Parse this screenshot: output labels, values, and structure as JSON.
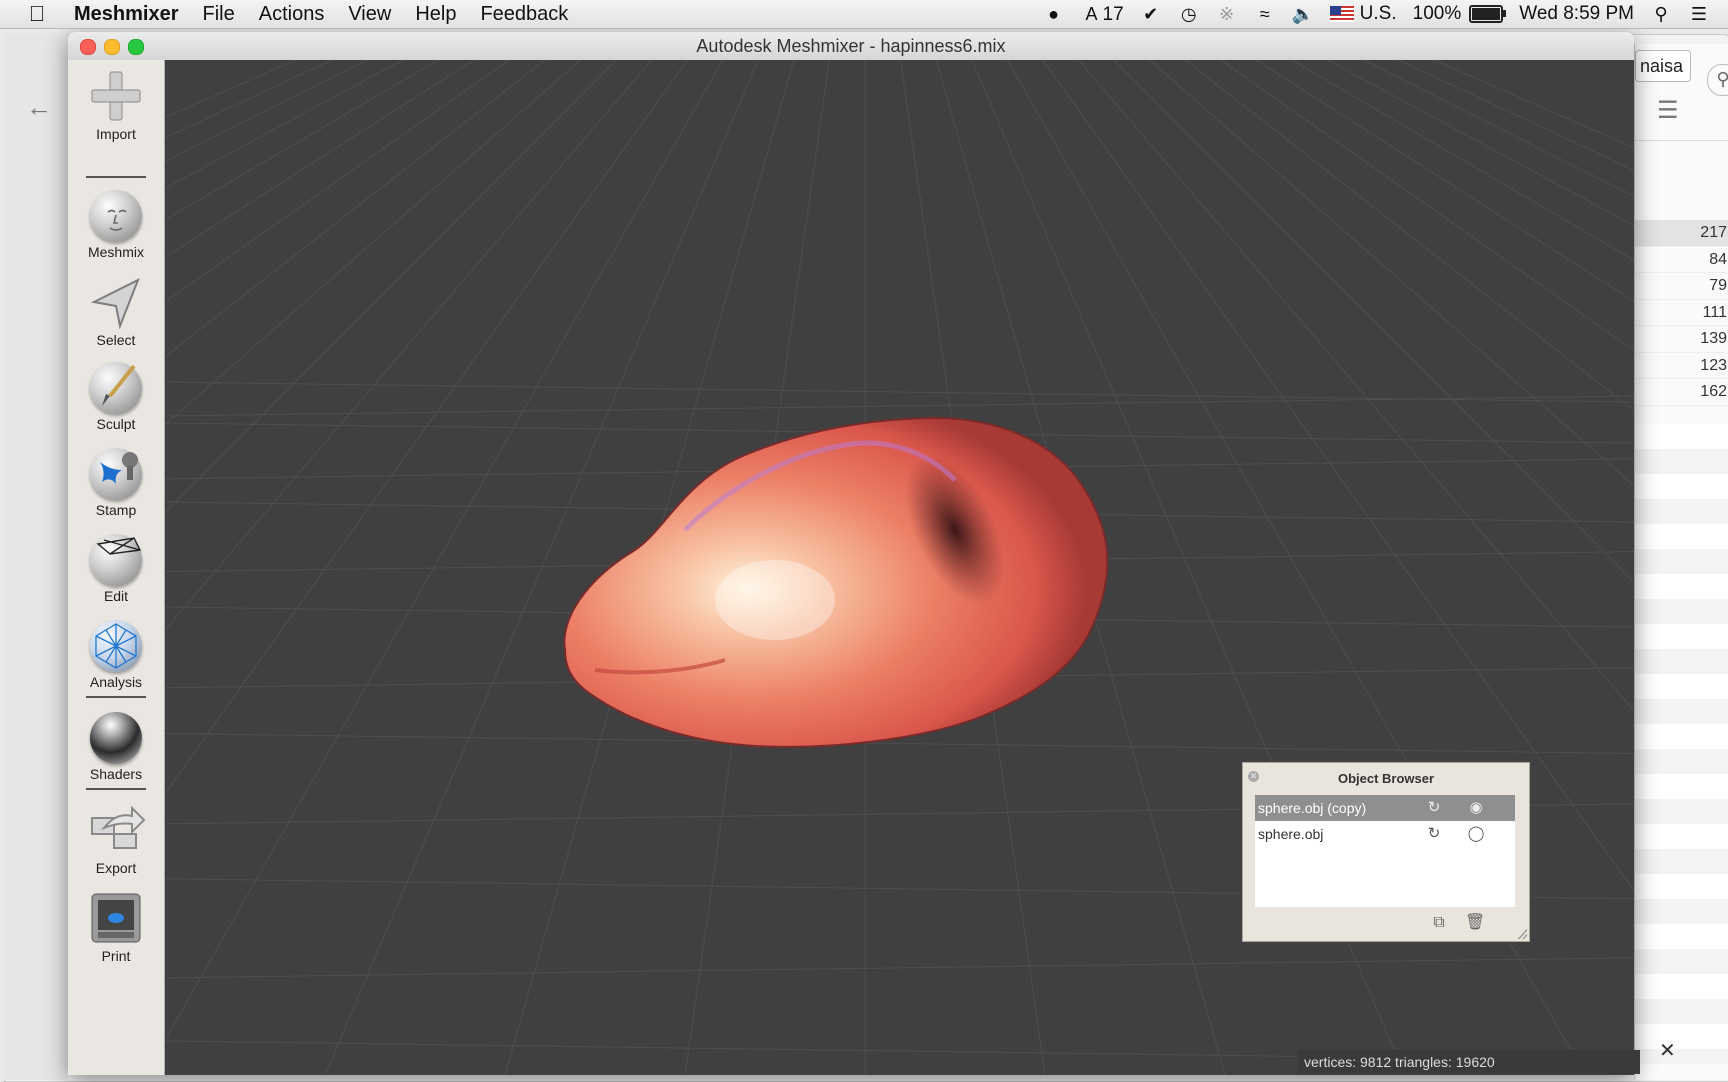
{
  "menubar": {
    "app_name": "Meshmixer",
    "menus": [
      "File",
      "Actions",
      "View",
      "Help",
      "Feedback"
    ],
    "status": {
      "notify_count": "17",
      "input_source": "U.S.",
      "battery": "100%",
      "battery_level": 1.0,
      "clock": "Wed 8:59 PM"
    }
  },
  "background_window": {
    "name_field": "naisa",
    "numbers": [
      "217",
      "84",
      "79",
      "111",
      "139",
      "123",
      "162"
    ]
  },
  "window": {
    "title": "Autodesk Meshmixer - hapinness6.mix"
  },
  "toolbar": {
    "tools": [
      {
        "label": "Import",
        "icon": "plus-icon"
      },
      {
        "label": "Meshmix",
        "icon": "face-ball-icon"
      },
      {
        "label": "Select",
        "icon": "arrow-pointer-icon"
      },
      {
        "label": "Sculpt",
        "icon": "brush-ball-icon"
      },
      {
        "label": "Stamp",
        "icon": "stamp-ball-icon"
      },
      {
        "label": "Edit",
        "icon": "wireframe-ball-icon"
      },
      {
        "label": "Analysis",
        "icon": "mesh-ball-icon"
      },
      {
        "label": "Shaders",
        "icon": "chrome-ball-icon"
      },
      {
        "label": "Export",
        "icon": "export-arrow-icon"
      },
      {
        "label": "Print",
        "icon": "printer-icon"
      }
    ]
  },
  "object_browser": {
    "title": "Object Browser",
    "items": [
      {
        "name": "sphere.obj (copy)",
        "selected": true
      },
      {
        "name": "sphere.obj",
        "selected": false
      }
    ]
  },
  "status_bar": {
    "text": "vertices: 9812 triangles: 19620"
  },
  "colors": {
    "viewport_bg": "#404040",
    "mesh_main": "#e8735f",
    "mesh_highlight": "#fff0d8"
  }
}
